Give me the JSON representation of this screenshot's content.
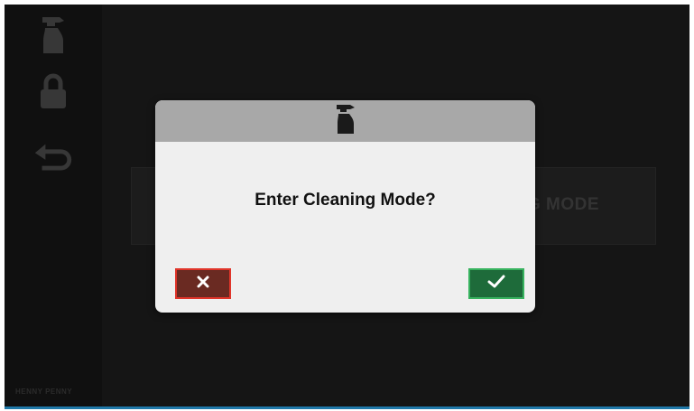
{
  "sidebar": {
    "icons": [
      "spray-bottle-icon",
      "lock-icon",
      "back-arrow-icon"
    ],
    "brand": "HENNY PENNY"
  },
  "main": {
    "cleaning_mode_button_label": "CLEANING MODE"
  },
  "dialog": {
    "header_icon": "spray-bottle-icon",
    "message": "Enter Cleaning Mode?",
    "cancel_icon": "close-icon",
    "confirm_icon": "check-icon"
  },
  "colors": {
    "background": "#1c1c1c",
    "dialog_bg": "#efefef",
    "dialog_header": "#a8a8a8",
    "cancel_fill": "#6a2a22",
    "cancel_border": "#e0352a",
    "confirm_fill": "#1e6b3a",
    "confirm_border": "#37b25e"
  }
}
